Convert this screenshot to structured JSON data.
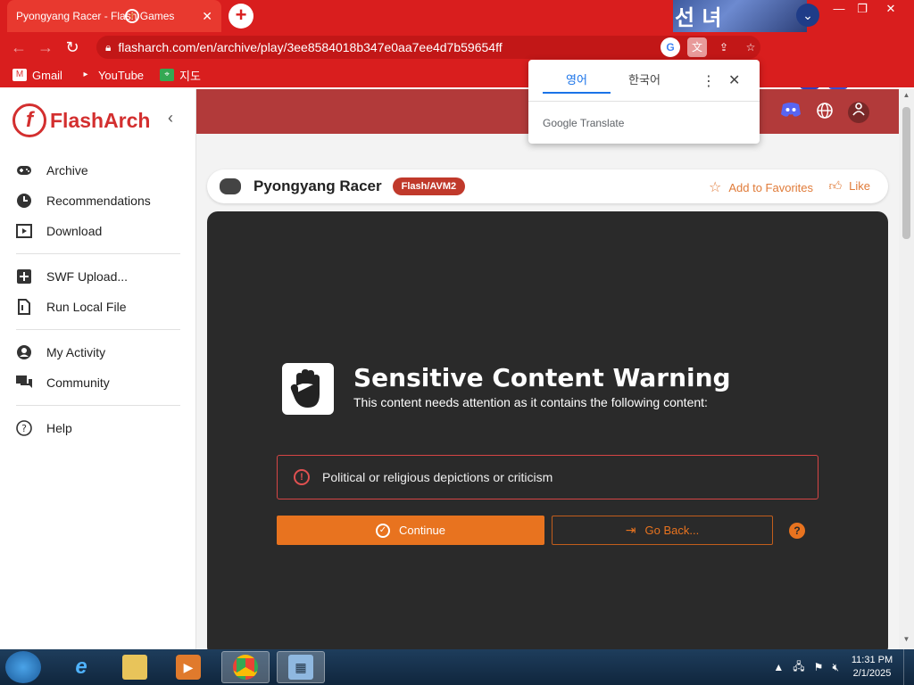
{
  "browser": {
    "tab_title": "Pyongyang Racer - Flash Games",
    "tab_close": "✕",
    "new_tab": "+",
    "strip_art_text": "선 녀",
    "url": "flasharch.com/en/archive/play/3ee8584018b347e0aa7ee4d7b59654ff",
    "bookmarks": [
      {
        "label": "Gmail",
        "icon": "gmail-icon"
      },
      {
        "label": "YouTube",
        "icon": "youtube-icon"
      },
      {
        "label": "지도",
        "icon": "maps-icon"
      }
    ]
  },
  "translate_popup": {
    "tabs": [
      "영어",
      "한국어"
    ],
    "active_tab": "영어",
    "brand": "Google Translate"
  },
  "sidebar": {
    "logo_text": "FlashArch",
    "logo_mark": "f",
    "items_group1": [
      {
        "label": "Archive",
        "icon": "gamepad-icon"
      },
      {
        "label": "Recommendations",
        "icon": "recommendation-icon"
      },
      {
        "label": "Download",
        "icon": "download-icon"
      }
    ],
    "items_group2": [
      {
        "label": "SWF Upload...",
        "icon": "upload-icon"
      },
      {
        "label": "Run Local File",
        "icon": "file-icon"
      }
    ],
    "items_group3": [
      {
        "label": "My Activity",
        "icon": "user-icon"
      },
      {
        "label": "Community",
        "icon": "chat-icon"
      }
    ],
    "items_group4": [
      {
        "label": "Help",
        "icon": "help-icon"
      }
    ]
  },
  "game": {
    "title": "Pyongyang Racer",
    "badge": "Flash/AVM2",
    "favorite_label": "Add to Favorites",
    "like_label": "Like"
  },
  "warning": {
    "title": "Sensitive Content Warning",
    "subtitle": "This content needs attention as it contains the following content:",
    "reason": "Political or religious depictions or criticism",
    "continue_label": "Continue",
    "back_label": "Go Back...",
    "help": "?"
  },
  "taskbar": {
    "time": "11:31 PM",
    "date": "2/1/2025"
  },
  "colors": {
    "chrome_red": "#d91e1e",
    "brand_red": "#d32f2f",
    "accent_orange": "#e8731f",
    "player_bg": "#2a2a2a"
  }
}
